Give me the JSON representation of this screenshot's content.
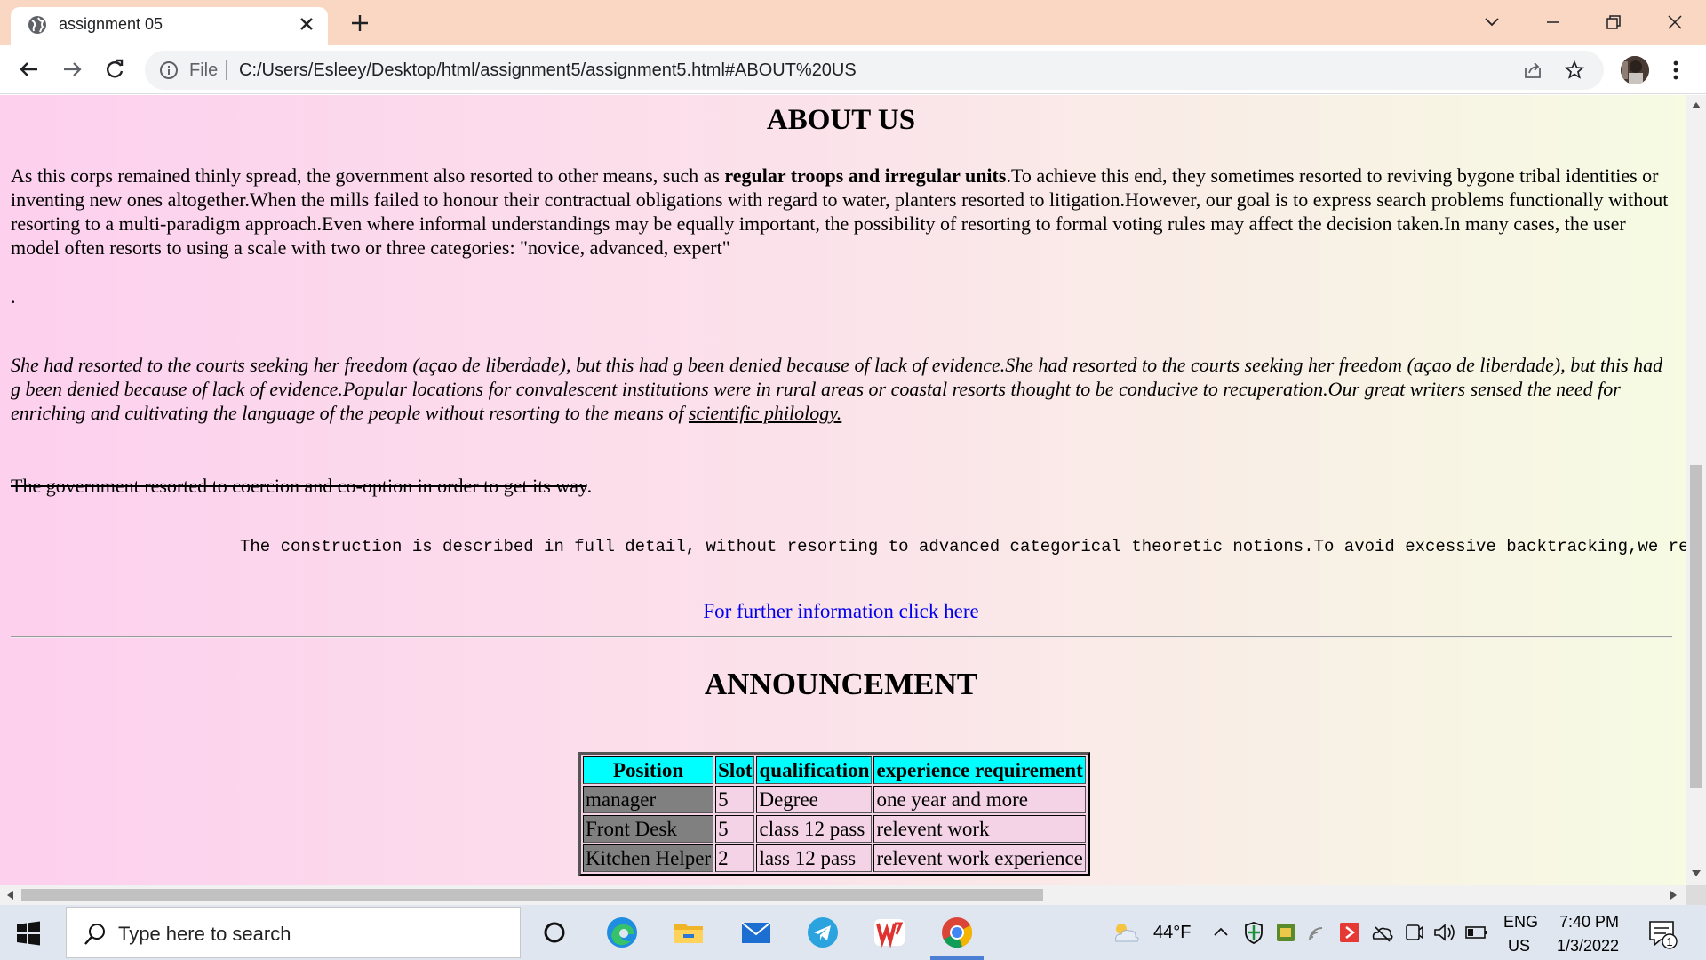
{
  "browser": {
    "tab_title": "assignment 05",
    "url_scheme": "File",
    "url": "C:/Users/Esleey/Desktop/html/assignment5/assignment5.html#ABOUT%20US"
  },
  "page": {
    "about_heading": "ABOUT US",
    "p1_before_bold": "As this corps remained thinly spread, the government also resorted to other means, such as ",
    "p1_bold": "regular troops and irregular units",
    "p1_after_bold": ".To achieve this end, they sometimes resorted to reviving bygone tribal identities or inventing new ones altogether.When the mills failed to honour their contractual obligations with regard to water, planters resorted to litigation.However, our goal is to express search problems functionally without resorting to a multi-paradigm approach.Even where informal understandings may be equally important, the possibility of resorting to formal voting rules may affect the decision taken.In many cases, the user model often resorts to using a scale with two or three categories: \"novice, advanced, expert\"",
    "dot": ".",
    "p2_text": "She had resorted to the courts seeking her freedom (açao de liberdade), but this had g been denied because of lack of evidence.She had resorted to the courts seeking her freedom (açao de liberdade), but this had g been denied because of lack of evidence.Popular locations for convalescent institutions were in rural areas or coastal resorts thought to be conducive to recuperation.Our great writers sensed the need for enriching and cultivating the language of the people without resorting to the means of ",
    "p2_link": "scientific philology.",
    "p3_strike": "The government resorted to coercion and co-option in order to get its way",
    "p3_end": ".",
    "marquee": "The construction is described in full detail, without resorting to advanced categorical theoretic notions.To avoid excessive backtracking,we resorted to",
    "further_link": "For further information click here",
    "announcement_heading": "ANNOUNCEMENT",
    "table": {
      "headers": [
        "Position",
        "Slot",
        "qualification",
        "experience requirement"
      ],
      "rows": [
        [
          "manager",
          "5",
          "Degree",
          "one year and more"
        ],
        [
          "Front Desk",
          "5",
          "class 12 pass",
          "relevent work"
        ],
        [
          "Kitchen Helper",
          "2",
          "lass 12 pass",
          "relevent work experience"
        ]
      ]
    }
  },
  "taskbar": {
    "search_placeholder": "Type here to search",
    "weather": "44°F",
    "lang_top": "ENG",
    "lang_bottom": "US",
    "time": "7:40 PM",
    "date": "1/3/2022",
    "notification_count": "1"
  }
}
